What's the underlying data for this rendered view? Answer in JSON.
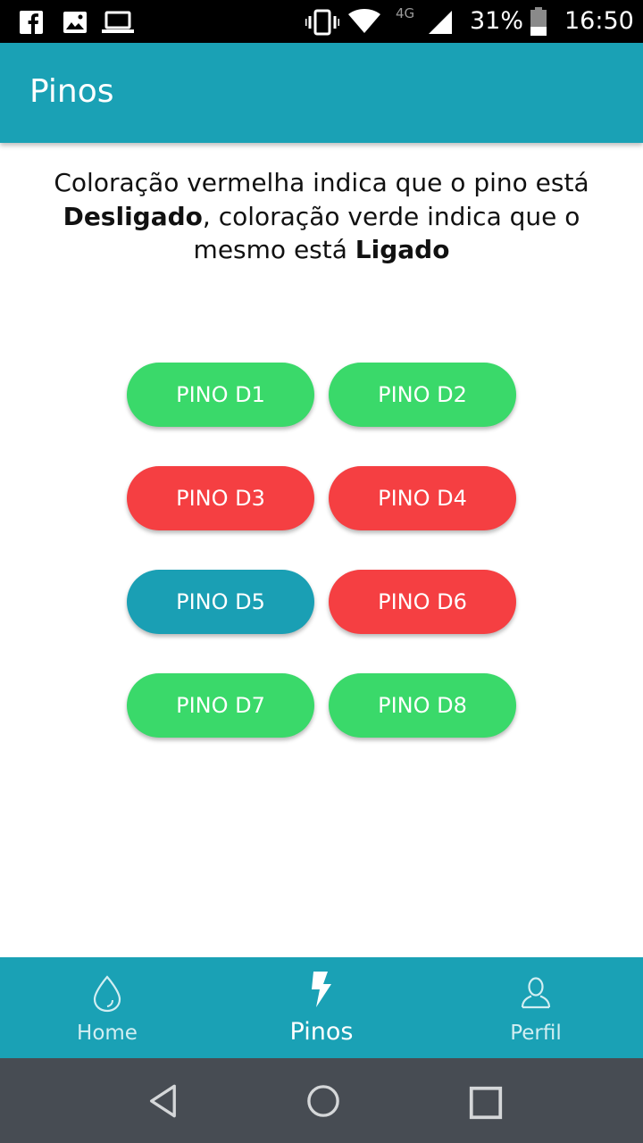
{
  "status_bar": {
    "network": "4G",
    "battery": "31%",
    "time": "16:50"
  },
  "app_bar": {
    "title": "Pinos"
  },
  "description": {
    "line1": "Coloração vermelha indica que o pino está",
    "bold1": "Desligado",
    "line2_rest": ", coloração verde indica que o",
    "line3_pre": "mesmo está ",
    "bold2": "Ligado"
  },
  "colors": {
    "on": "#3ad96a",
    "off": "#f53f42",
    "selected": "#1a9fb4",
    "primary": "#1aa1b5"
  },
  "pins": [
    {
      "label": "PINO D1",
      "state": "on"
    },
    {
      "label": "PINO D2",
      "state": "on"
    },
    {
      "label": "PINO D3",
      "state": "off"
    },
    {
      "label": "PINO D4",
      "state": "off"
    },
    {
      "label": "PINO D5",
      "state": "selected"
    },
    {
      "label": "PINO D6",
      "state": "off"
    },
    {
      "label": "PINO D7",
      "state": "on"
    },
    {
      "label": "PINO D8",
      "state": "on"
    }
  ],
  "bottom_nav": {
    "items": [
      {
        "label": "Home",
        "icon": "water-drop-icon",
        "active": false
      },
      {
        "label": "Pinos",
        "icon": "lightning-icon",
        "active": true
      },
      {
        "label": "Perfil",
        "icon": "person-icon",
        "active": false
      }
    ]
  },
  "system_nav": [
    "back-icon",
    "home-circle-icon",
    "recents-icon"
  ]
}
